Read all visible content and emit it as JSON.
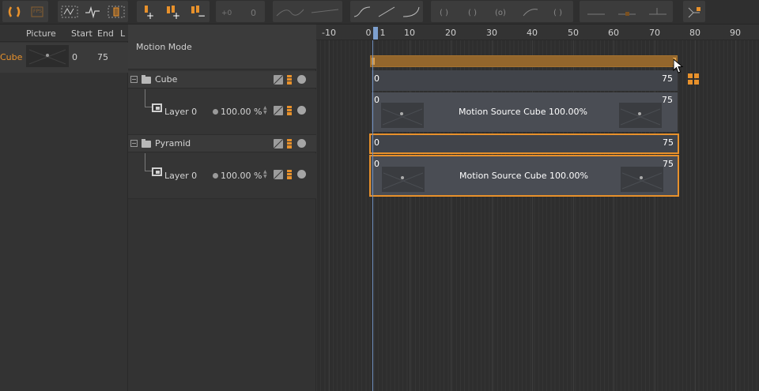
{
  "toolbar": {
    "groups": [
      {
        "buttons": [
          "brackets-icon",
          "keyframe-box-icon"
        ]
      },
      {
        "buttons": [
          "curve-frame-icon",
          "pulse-icon",
          "bar-icon"
        ]
      },
      {
        "buttons": [
          "add-key-icon",
          "add-multiple-key-icon",
          "remove-key-icon"
        ]
      },
      {
        "buttons": [
          "plus-zero-icon",
          "zero-icon"
        ]
      },
      {
        "buttons": [
          "ease-curve-icon",
          "step-curve-icon"
        ]
      },
      {
        "buttons": [
          "linear-curve-icon",
          "curve-icon",
          "smooth-curve-icon"
        ]
      },
      {
        "buttons": [
          "loop-icon",
          "loop-alt-icon",
          "loop-offset-icon",
          "loop-curve-icon",
          "loop-end-icon"
        ]
      },
      {
        "buttons": [
          "flat-line-icon",
          "tangent-icon",
          "shift-icon"
        ]
      },
      {
        "buttons": [
          "snap-icon"
        ]
      }
    ],
    "accent": "#e8912b"
  },
  "object_list": {
    "headers": {
      "picture": "Picture",
      "start": "Start",
      "end": "End",
      "extra": "L"
    },
    "row": {
      "name": "Cube",
      "start": "0",
      "end": "75"
    }
  },
  "layers": {
    "mode_label": "Motion Mode",
    "groups": [
      {
        "name": "Cube",
        "layer": {
          "name": "Layer 0",
          "strength": "100.00 %"
        }
      },
      {
        "name": "Pyramid",
        "layer": {
          "name": "Layer 0",
          "strength": "100.00 %"
        }
      }
    ]
  },
  "timeline": {
    "ruler": [
      "-10",
      "0",
      "1",
      "10",
      "20",
      "30",
      "40",
      "50",
      "60",
      "70",
      "80",
      "90"
    ],
    "current_frame": "0",
    "clips": [
      {
        "start": "0",
        "end": "75",
        "title": "",
        "selected": false
      },
      {
        "start": "0",
        "end": "75",
        "title": "Motion Source Cube  100.00%",
        "selected": false
      },
      {
        "start": "0",
        "end": "75",
        "title": "",
        "selected": true
      },
      {
        "start": "0",
        "end": "75",
        "title": "Motion Source Cube  100.00%",
        "selected": true
      }
    ],
    "summary_color": "#93662c",
    "selection_color": "#e8912b"
  }
}
